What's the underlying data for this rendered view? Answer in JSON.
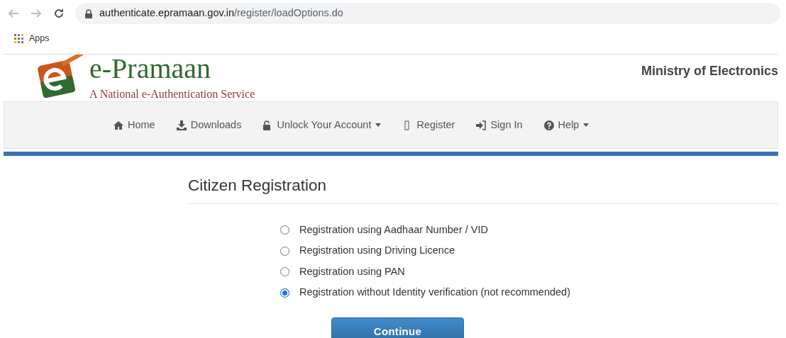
{
  "browser": {
    "url_host": "authenticate.epramaan.gov.in",
    "url_path": "/register/loadOptions.do",
    "bookmarks": [
      {
        "label": "Apps"
      }
    ]
  },
  "header": {
    "title": "e-Pramaan",
    "subtitle": "A National e-Authentication Service",
    "ministry": "Ministry of Electronics"
  },
  "nav": [
    {
      "label": "Home",
      "kind": "home",
      "dropdown": false
    },
    {
      "label": "Downloads",
      "kind": "download",
      "dropdown": false
    },
    {
      "label": "Unlock Your Account",
      "kind": "unlock",
      "dropdown": true
    },
    {
      "label": "Register",
      "kind": "missing",
      "dropdown": false
    },
    {
      "label": "Sign In",
      "kind": "signin",
      "dropdown": false
    },
    {
      "label": "Help",
      "kind": "help",
      "dropdown": true
    }
  ],
  "form": {
    "heading": "Citizen Registration",
    "options": [
      {
        "label": "Registration using Aadhaar Number / VID",
        "selected": false
      },
      {
        "label": "Registration using Driving Licence",
        "selected": false
      },
      {
        "label": "Registration using PAN",
        "selected": false
      },
      {
        "label": "Registration without Identity verification (not recommended)",
        "selected": true
      }
    ],
    "button": "Continue"
  }
}
